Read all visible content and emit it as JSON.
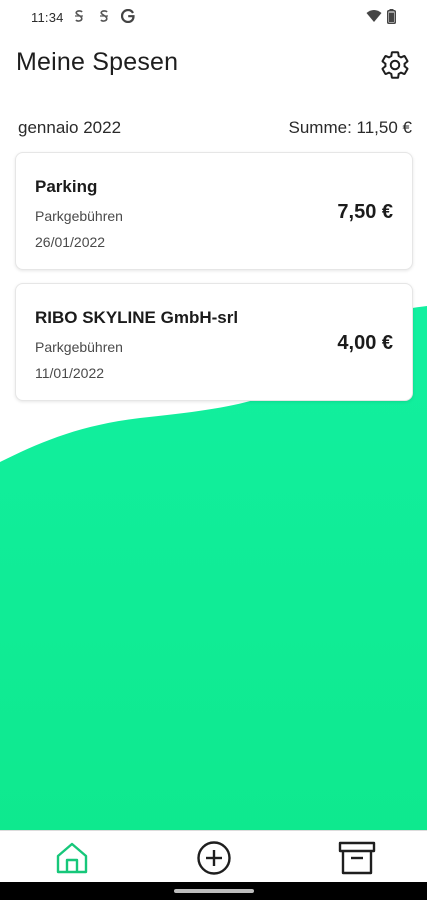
{
  "status_bar": {
    "time": "11:34",
    "notification_icons": [
      "s-sync-icon",
      "s-sync-icon",
      "google-icon"
    ],
    "system_icons": [
      "wifi-icon",
      "battery-icon"
    ]
  },
  "header": {
    "title": "Meine Spesen",
    "settings_icon": "gear-icon"
  },
  "summary": {
    "month": "gennaio 2022",
    "total": "Summe: 11,50 €"
  },
  "expenses": [
    {
      "title": "Parking",
      "category": "Parkgebühren",
      "date": "26/01/2022",
      "amount": "7,50 €"
    },
    {
      "title": "RIBO SKYLINE GmbH-srl",
      "category": "Parkgebühren",
      "date": "11/01/2022",
      "amount": "4,00 €"
    }
  ],
  "bottom_nav": {
    "items": [
      {
        "icon": "home-icon",
        "active": true
      },
      {
        "icon": "add-circle-icon",
        "active": false
      },
      {
        "icon": "archive-icon",
        "active": false
      }
    ]
  },
  "colors": {
    "accent": "#0fe88e",
    "accent_light": "#12f0a0",
    "active_icon": "#17c77a",
    "text": "#1d1d1d"
  }
}
